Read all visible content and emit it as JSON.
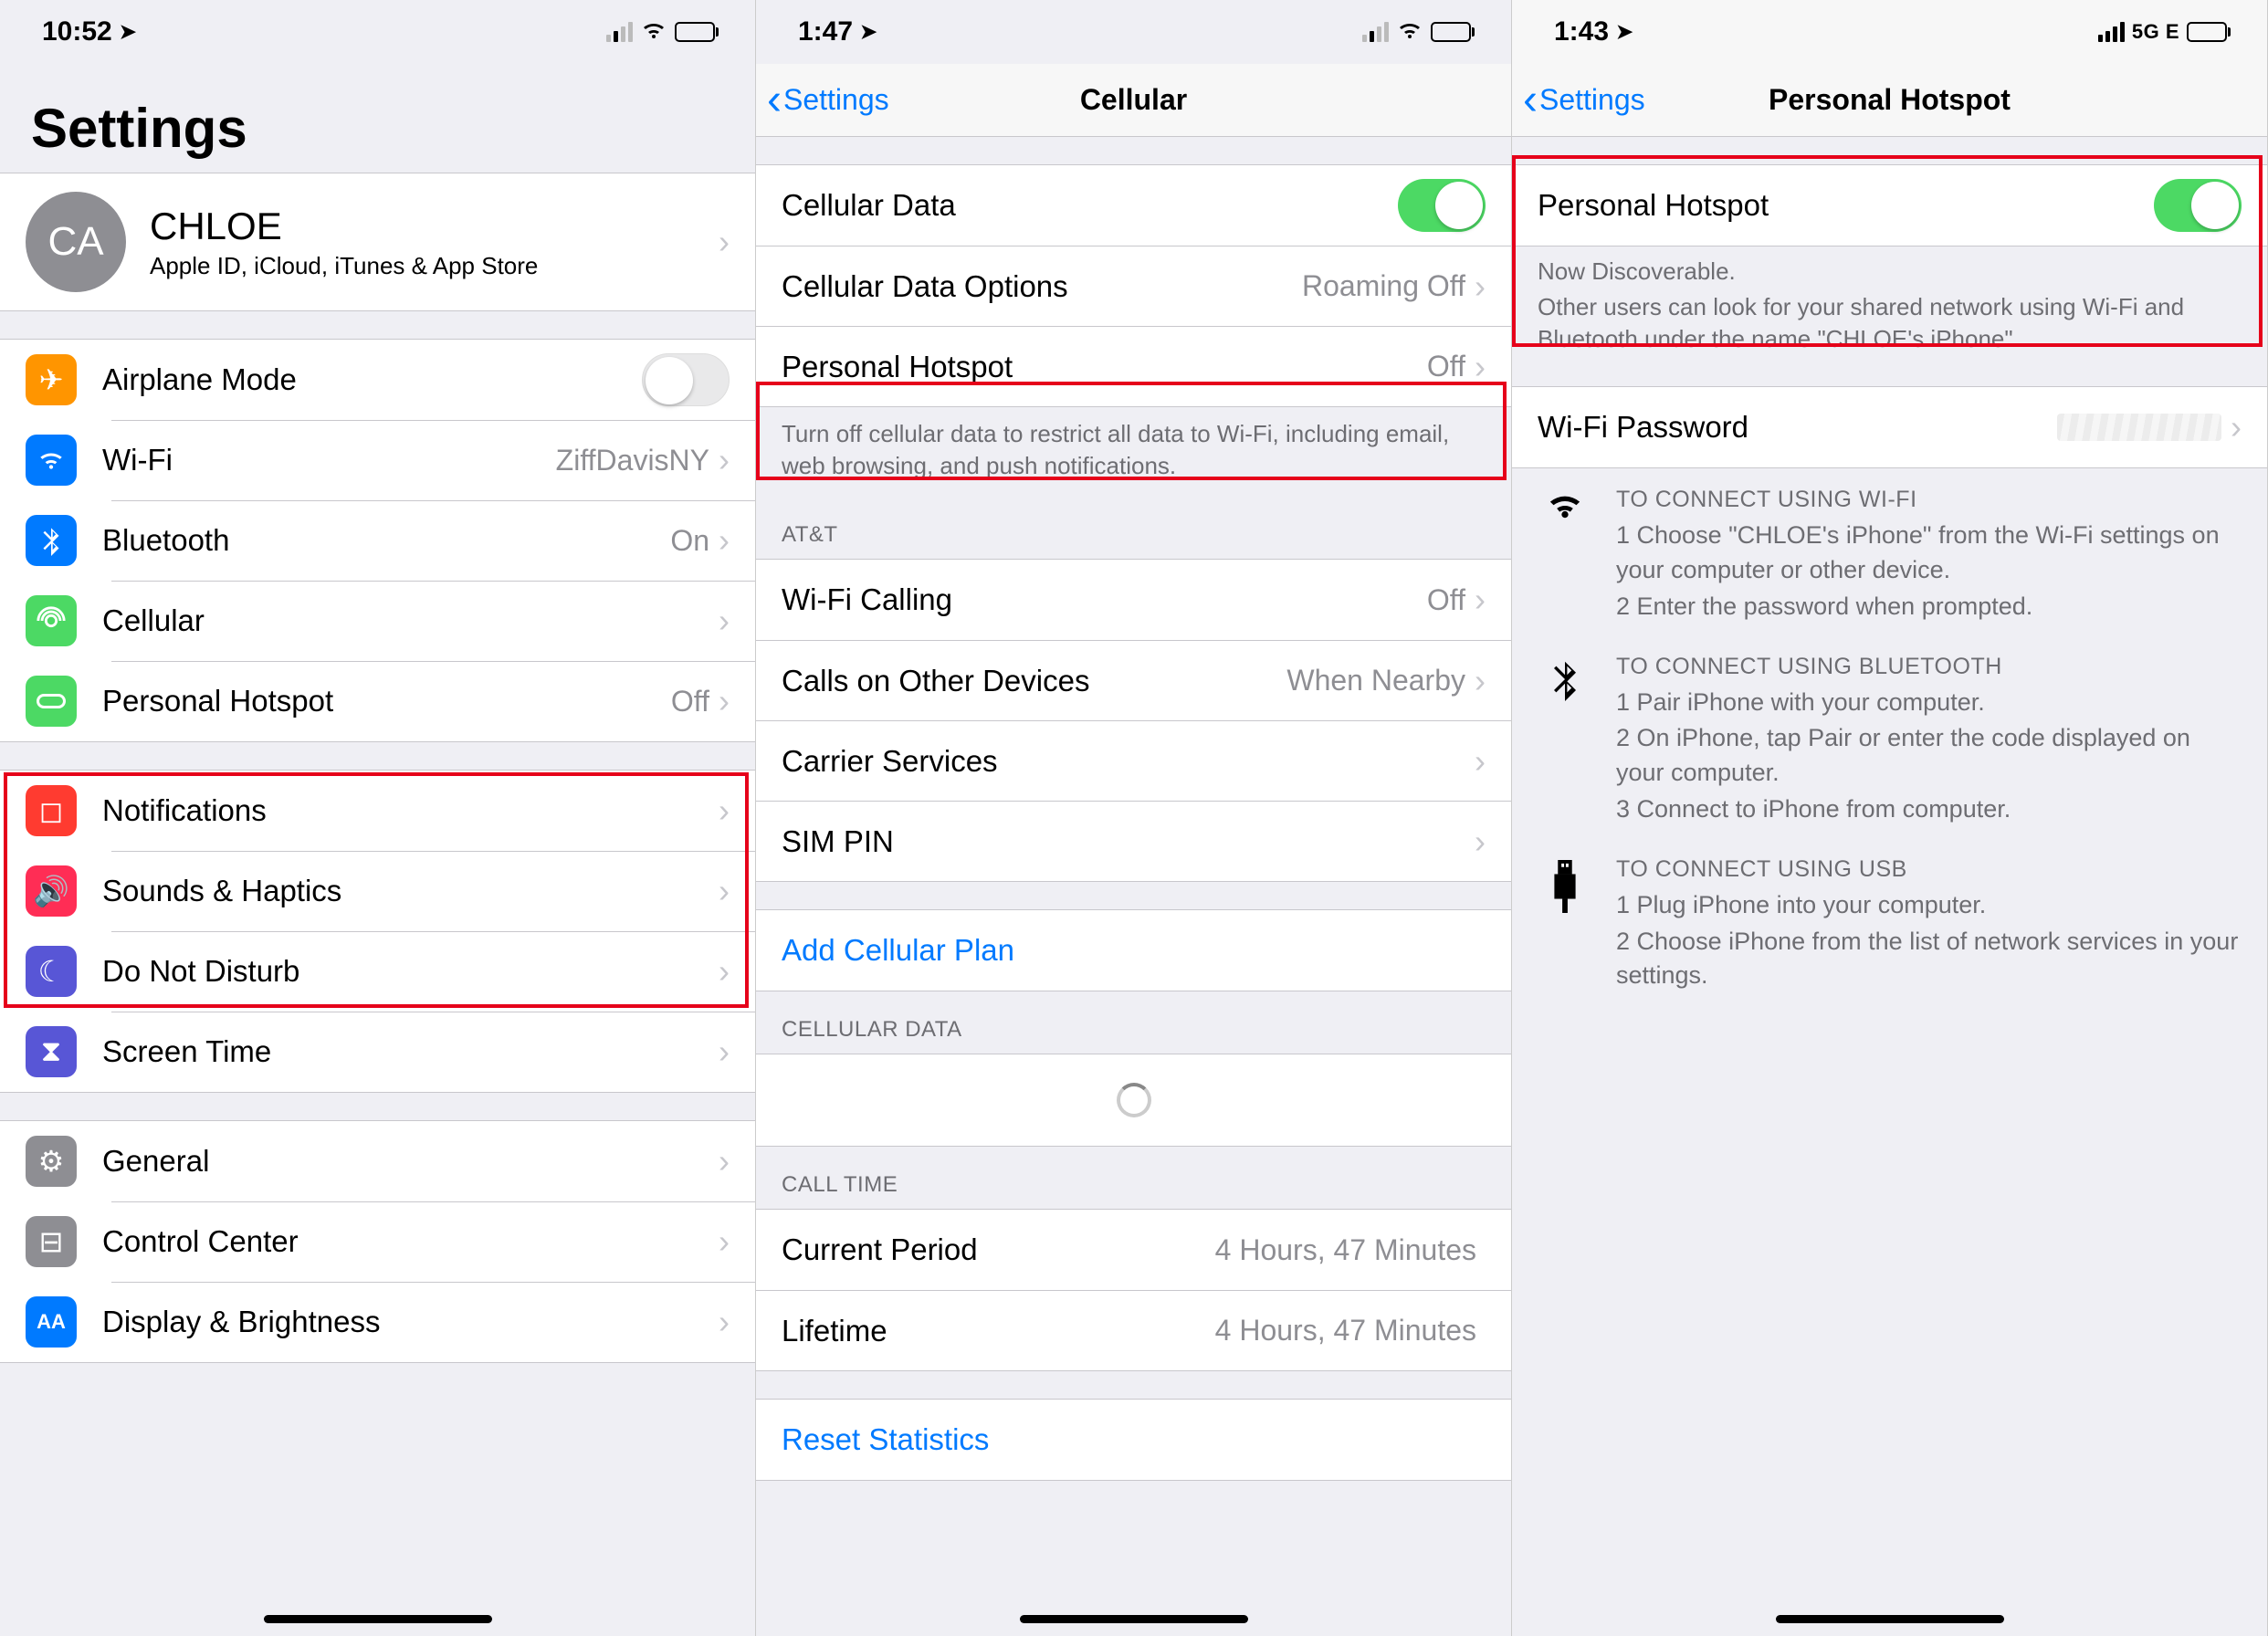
{
  "pane1": {
    "status_time": "10:52",
    "large_title": "Settings",
    "profile": {
      "initials": "CA",
      "name": "CHLOE",
      "subtitle": "Apple ID, iCloud, iTunes & App Store"
    },
    "group1": [
      {
        "label": "Airplane Mode",
        "value": "",
        "type": "switch",
        "on": false
      },
      {
        "label": "Wi-Fi",
        "value": "ZiffDavisNY",
        "type": "nav"
      },
      {
        "label": "Bluetooth",
        "value": "On",
        "type": "nav"
      },
      {
        "label": "Cellular",
        "value": "",
        "type": "nav"
      },
      {
        "label": "Personal Hotspot",
        "value": "Off",
        "type": "nav"
      }
    ],
    "group2": [
      {
        "label": "Notifications"
      },
      {
        "label": "Sounds & Haptics"
      },
      {
        "label": "Do Not Disturb"
      },
      {
        "label": "Screen Time"
      }
    ],
    "group3": [
      {
        "label": "General"
      },
      {
        "label": "Control Center"
      },
      {
        "label": "Display & Brightness"
      }
    ]
  },
  "pane2": {
    "status_time": "1:47",
    "nav_back": "Settings",
    "nav_title": "Cellular",
    "group1": [
      {
        "label": "Cellular Data",
        "type": "switch",
        "on": true
      },
      {
        "label": "Cellular Data Options",
        "value": "Roaming Off",
        "type": "nav"
      },
      {
        "label": "Personal Hotspot",
        "value": "Off",
        "type": "nav"
      }
    ],
    "group1_footer": "Turn off cellular data to restrict all data to Wi-Fi, including email, web browsing, and push notifications.",
    "group2_header": "AT&T",
    "group2": [
      {
        "label": "Wi-Fi Calling",
        "value": "Off"
      },
      {
        "label": "Calls on Other Devices",
        "value": "When Nearby"
      },
      {
        "label": "Carrier Services",
        "value": ""
      },
      {
        "label": "SIM PIN",
        "value": ""
      }
    ],
    "add_plan": "Add Cellular Plan",
    "cell_data_header": "CELLULAR DATA",
    "call_time_header": "CALL TIME",
    "call_time": [
      {
        "label": "Current Period",
        "value": "4 Hours, 47 Minutes"
      },
      {
        "label": "Lifetime",
        "value": "4 Hours, 47 Minutes"
      }
    ],
    "reset": "Reset Statistics"
  },
  "pane3": {
    "status_time": "1:43",
    "status_net": "5G E",
    "nav_back": "Settings",
    "nav_title": "Personal Hotspot",
    "toggle_label": "Personal Hotspot",
    "discoverable": "Now Discoverable.",
    "discoverable_body": "Other users can look for your shared network using Wi-Fi and Bluetooth under the name \"CHLOE's iPhone\".",
    "wifi_password_label": "Wi-Fi Password",
    "instructions": {
      "wifi": {
        "head": "TO CONNECT USING WI-FI",
        "lines": [
          "1 Choose \"CHLOE's iPhone\" from the Wi-Fi settings on your computer or other device.",
          "2 Enter the password when prompted."
        ]
      },
      "bt": {
        "head": "TO CONNECT USING BLUETOOTH",
        "lines": [
          "1 Pair iPhone with your computer.",
          "2 On iPhone, tap Pair or enter the code displayed on your computer.",
          "3 Connect to iPhone from computer."
        ]
      },
      "usb": {
        "head": "TO CONNECT USING USB",
        "lines": [
          "1 Plug iPhone into your computer.",
          "2 Choose iPhone from the list of network services in your settings."
        ]
      }
    }
  }
}
